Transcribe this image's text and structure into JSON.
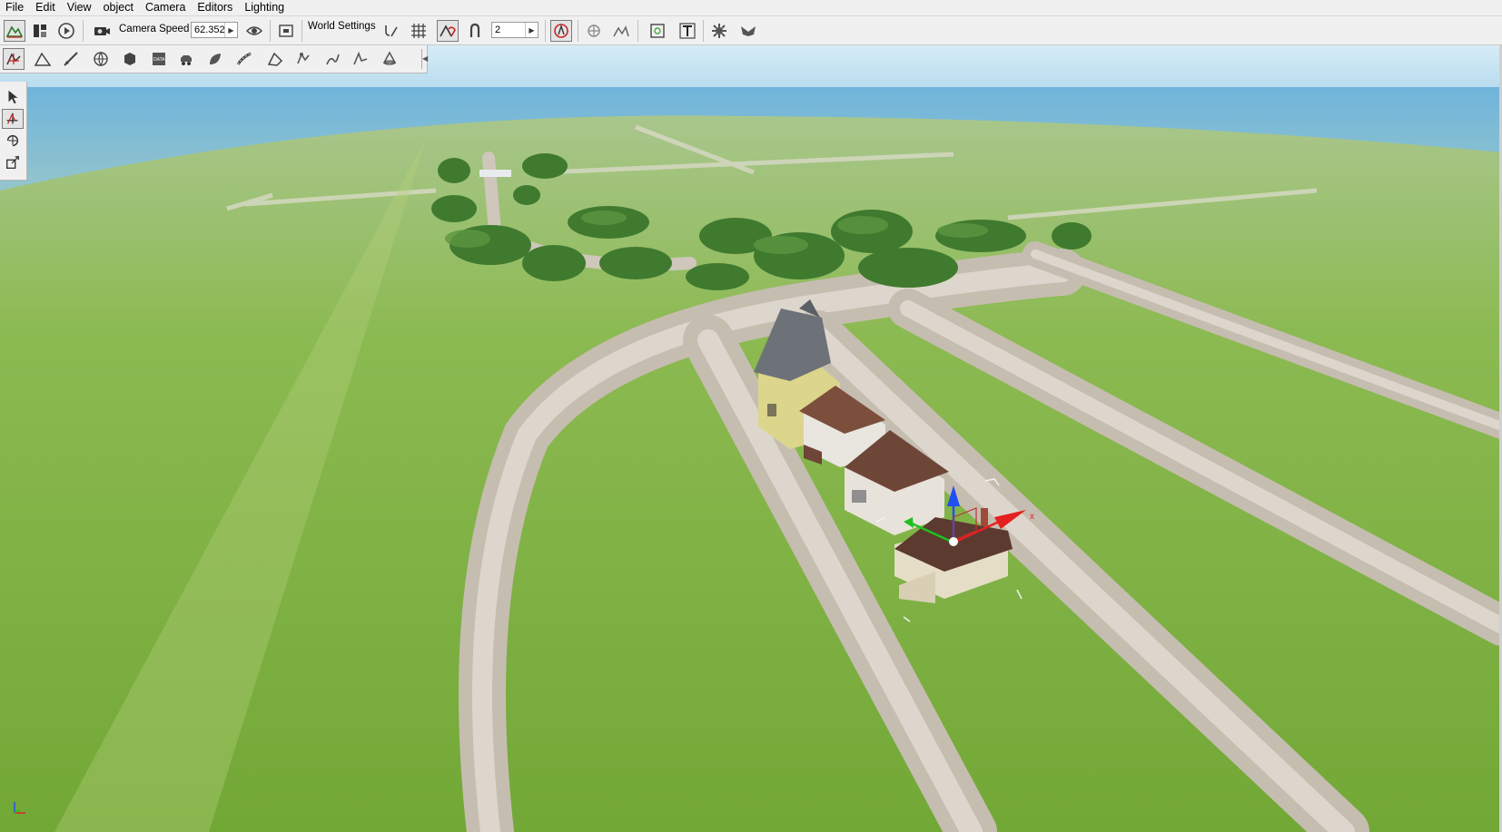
{
  "menu": [
    "File",
    "Edit",
    "View",
    "object",
    "Camera",
    "Editors",
    "Lighting"
  ],
  "toolbar": {
    "camera_speed_label": "Camera Speed",
    "camera_speed_value": "62.352",
    "world_settings_label": "World Settings",
    "snap_value": "2"
  },
  "colors": {
    "ui_background": "#f0f0f0",
    "sky": "#cfe6f3",
    "sea": "#6aaed8",
    "grass": "#7fb23f",
    "road": "#d1c8bd",
    "gizmo_x": "#e52020",
    "gizmo_y": "#20c020",
    "gizmo_z": "#2050f0"
  },
  "viewport": {
    "gizmo_axis_label": "x"
  }
}
